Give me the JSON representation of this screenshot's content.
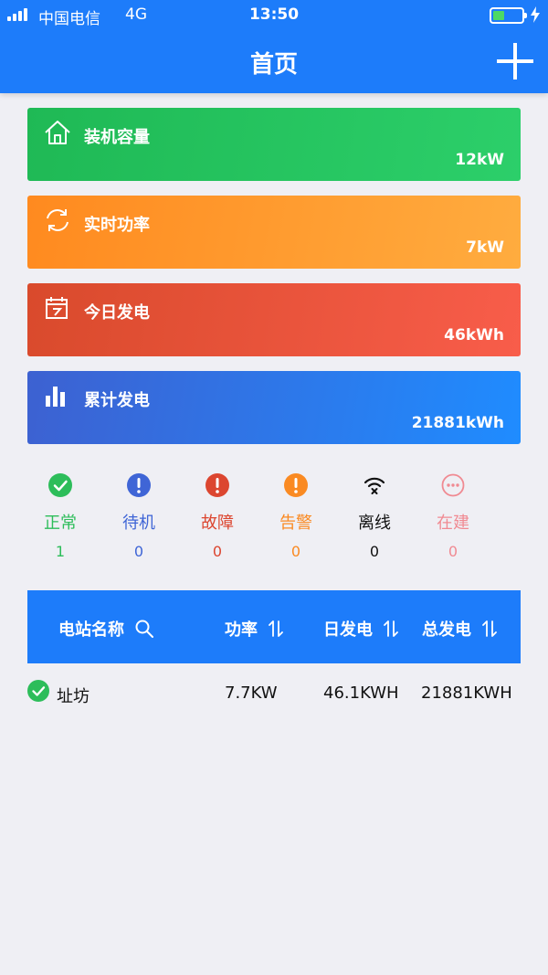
{
  "status_bar": {
    "carrier": "中国电信",
    "network": "4G",
    "time": "13:50"
  },
  "header": {
    "title": "首页",
    "add_icon": "plus-icon"
  },
  "cards": [
    {
      "label": "装机容量",
      "value": "12kW",
      "icon": "house-icon",
      "gradient": [
        "#1fb955",
        "#2ccf6a"
      ]
    },
    {
      "label": "实时功率",
      "value": "7kW",
      "icon": "refresh-icon",
      "gradient": [
        "#ff8a1f",
        "#ffac3f"
      ]
    },
    {
      "label": "今日发电",
      "value": "46kWh",
      "icon": "calendar-icon",
      "gradient": [
        "#d94a2c",
        "#f85d4a"
      ]
    },
    {
      "label": "累计发电",
      "value": "21881kWh",
      "icon": "bar-chart-icon",
      "gradient": [
        "#3d61d1",
        "#1f8cff"
      ]
    }
  ],
  "status_filters": [
    {
      "label": "正常",
      "count": "1",
      "color": "#2dbd5a",
      "icon": "check-circle-icon"
    },
    {
      "label": "待机",
      "count": "0",
      "color": "#3f65d6",
      "icon": "exclamation-circle-icon"
    },
    {
      "label": "故障",
      "count": "0",
      "color": "#dc4630",
      "icon": "exclamation-circle-icon"
    },
    {
      "label": "告警",
      "count": "0",
      "color": "#fa8a22",
      "icon": "exclamation-circle-icon"
    },
    {
      "label": "离线",
      "count": "0",
      "color": "#111111",
      "icon": "wifi-off-icon"
    },
    {
      "label": "在建",
      "count": "0",
      "color": "#f08a92",
      "icon": "ellipsis-circle-icon"
    }
  ],
  "table": {
    "headers": {
      "name": "电站名称",
      "power": "功率",
      "daily": "日发电",
      "total": "总发电"
    },
    "rows": [
      {
        "name": "址坊",
        "power": "7.7KW",
        "daily": "46.1KWH",
        "total": "21881KWH",
        "status_color": "#2dbd5a"
      }
    ]
  },
  "colors": {
    "primary": "#1d7cfa",
    "background": "#efeff4"
  }
}
